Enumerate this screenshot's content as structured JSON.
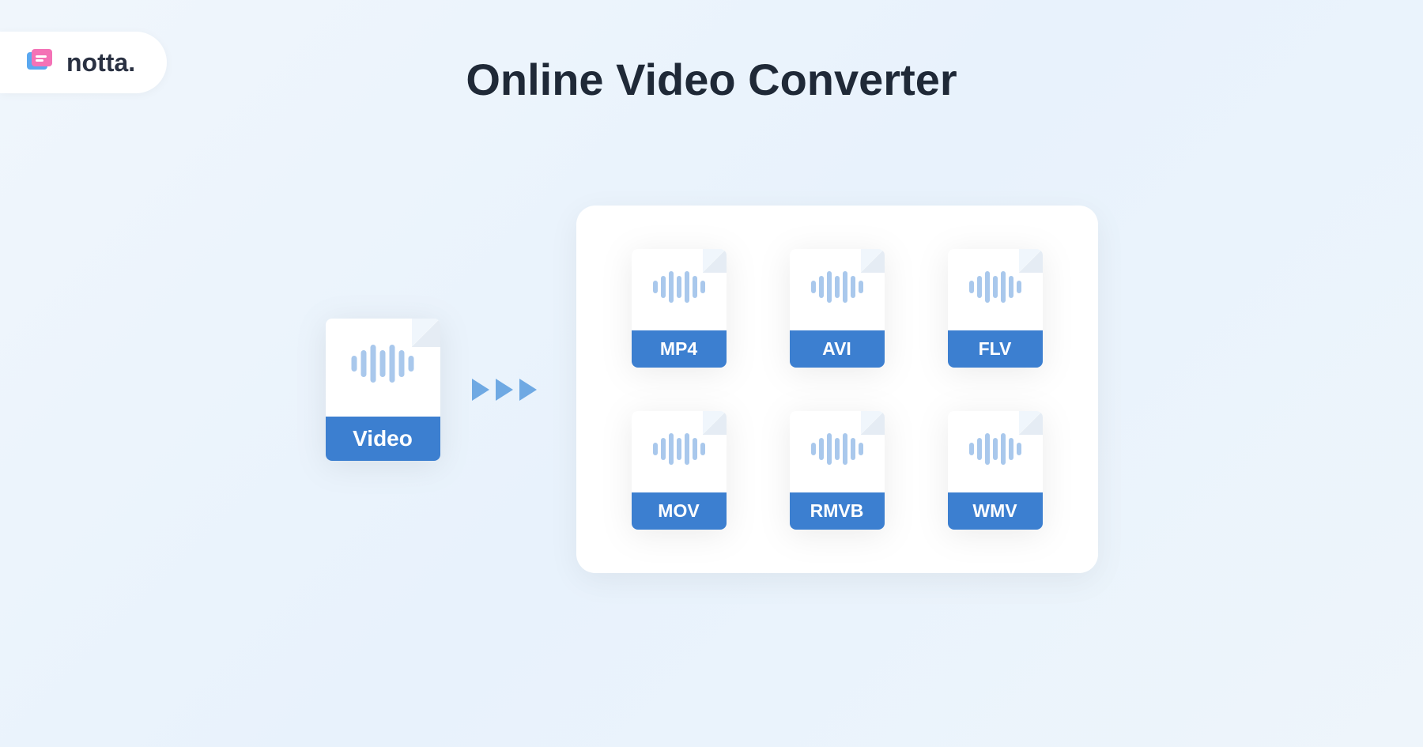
{
  "brand": {
    "name": "notta."
  },
  "heading": "Online Video Converter",
  "source": {
    "label": "Video"
  },
  "outputs": [
    {
      "label": "MP4"
    },
    {
      "label": "AVI"
    },
    {
      "label": "FLV"
    },
    {
      "label": "MOV"
    },
    {
      "label": "RMVB"
    },
    {
      "label": "WMV"
    }
  ],
  "colors": {
    "accent": "#3c7fd0",
    "wave": "#a9c8ec",
    "arrow": "#6fa9e3",
    "text_dark": "#1f2937"
  }
}
